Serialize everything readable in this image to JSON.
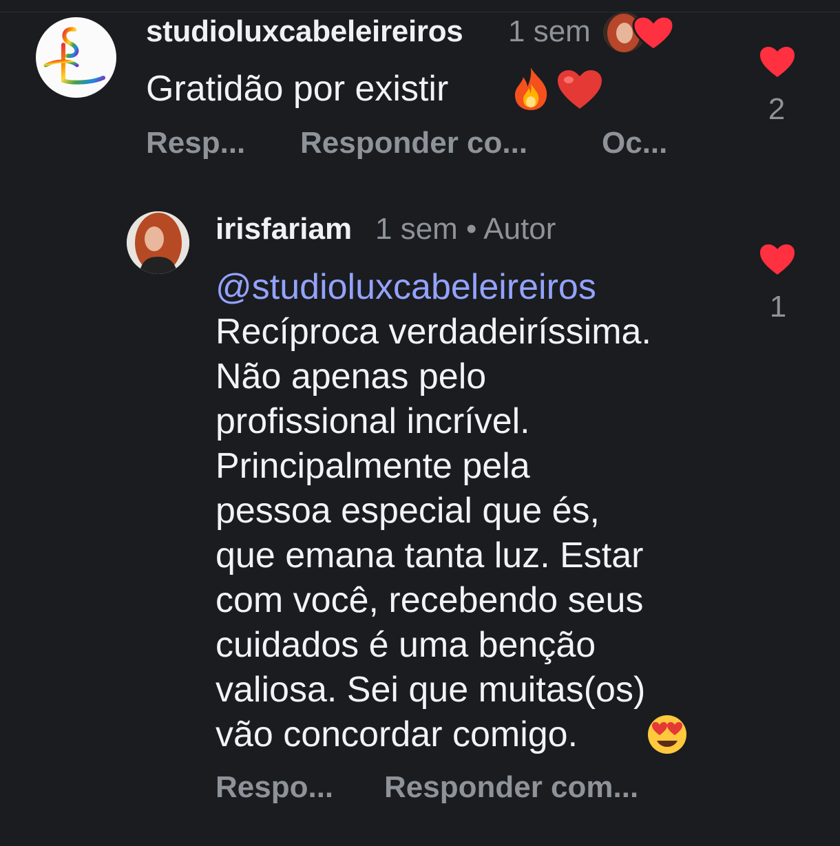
{
  "comment": {
    "username": "studioluxcabeleireiros",
    "time": "1 sem",
    "text": "Gratidão por existir",
    "emojis": [
      "fire-emoji",
      "red-heart-emoji"
    ],
    "actions": [
      "Resp...",
      "Responder co...",
      "Oc..."
    ],
    "likes": "2"
  },
  "reply": {
    "username": "irisfariam",
    "meta": "1 sem • Autor",
    "mention": "@studioluxcabeleireiros",
    "lines": [
      "Recíproca verdadeiríssima.",
      "Não apenas pelo",
      "profissional incrível.",
      "Principalmente pela",
      "pessoa especial que és,",
      "que emana tanta luz. Estar",
      "com você, recebendo seus",
      "cuidados é uma benção",
      "valiosa. Sei que muitas(os)",
      "vão concordar comigo."
    ],
    "emoji": "heart-eyes-emoji",
    "actions": [
      "Respo...",
      "Responder com..."
    ],
    "likes": "1"
  },
  "colors": {
    "background": "#1a1c1f",
    "primary_text": "#f2f3f5",
    "secondary_text": "#8e939a",
    "mention": "#93a3ff",
    "like": "#ff3040"
  }
}
